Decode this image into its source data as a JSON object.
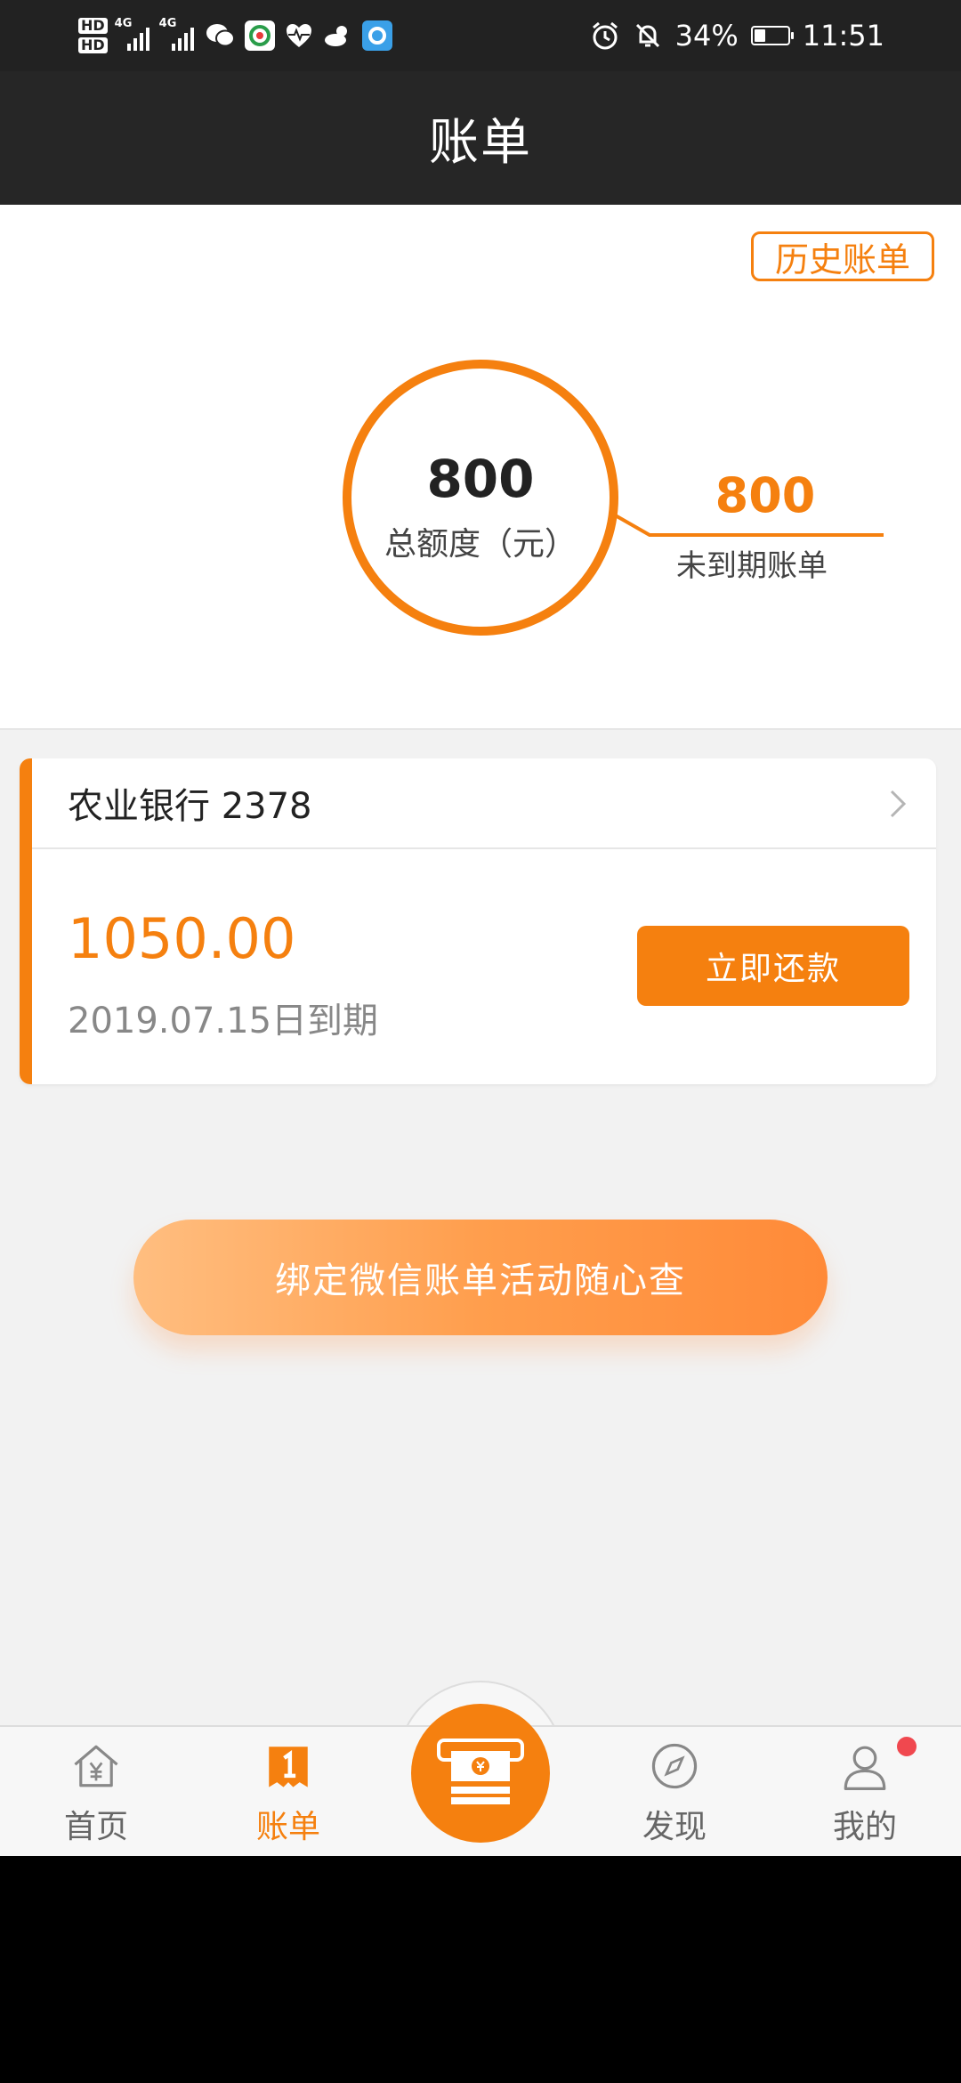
{
  "status_bar": {
    "hd1": "HD",
    "hd2": "HD",
    "net1": "4G",
    "net2": "4G",
    "battery_pct": "34%",
    "battery_level": 0.34,
    "time": "11:51"
  },
  "nav": {
    "title": "账单"
  },
  "summary": {
    "history_label": "历史账单",
    "total_value": "800",
    "total_label": "总额度（元）",
    "due_value": "800",
    "due_label": "未到期账单"
  },
  "bill": {
    "bank": "农业银行 2378",
    "amount": "1050.00",
    "due_date": "2019.07.15日到期",
    "pay_label": "立即还款"
  },
  "wechat": {
    "label": "绑定微信账单活动随心查"
  },
  "tabs": [
    {
      "label": "首页",
      "icon": "home-yuan-icon"
    },
    {
      "label": "账单",
      "icon": "bill-icon"
    },
    {
      "label": "",
      "icon": "cash-icon"
    },
    {
      "label": "发现",
      "icon": "compass-icon"
    },
    {
      "label": "我的",
      "icon": "user-icon"
    }
  ],
  "colors": {
    "accent": "#f5800f",
    "status_bar": "#222222",
    "nav_bar": "#262626",
    "badge": "#f0484f"
  }
}
